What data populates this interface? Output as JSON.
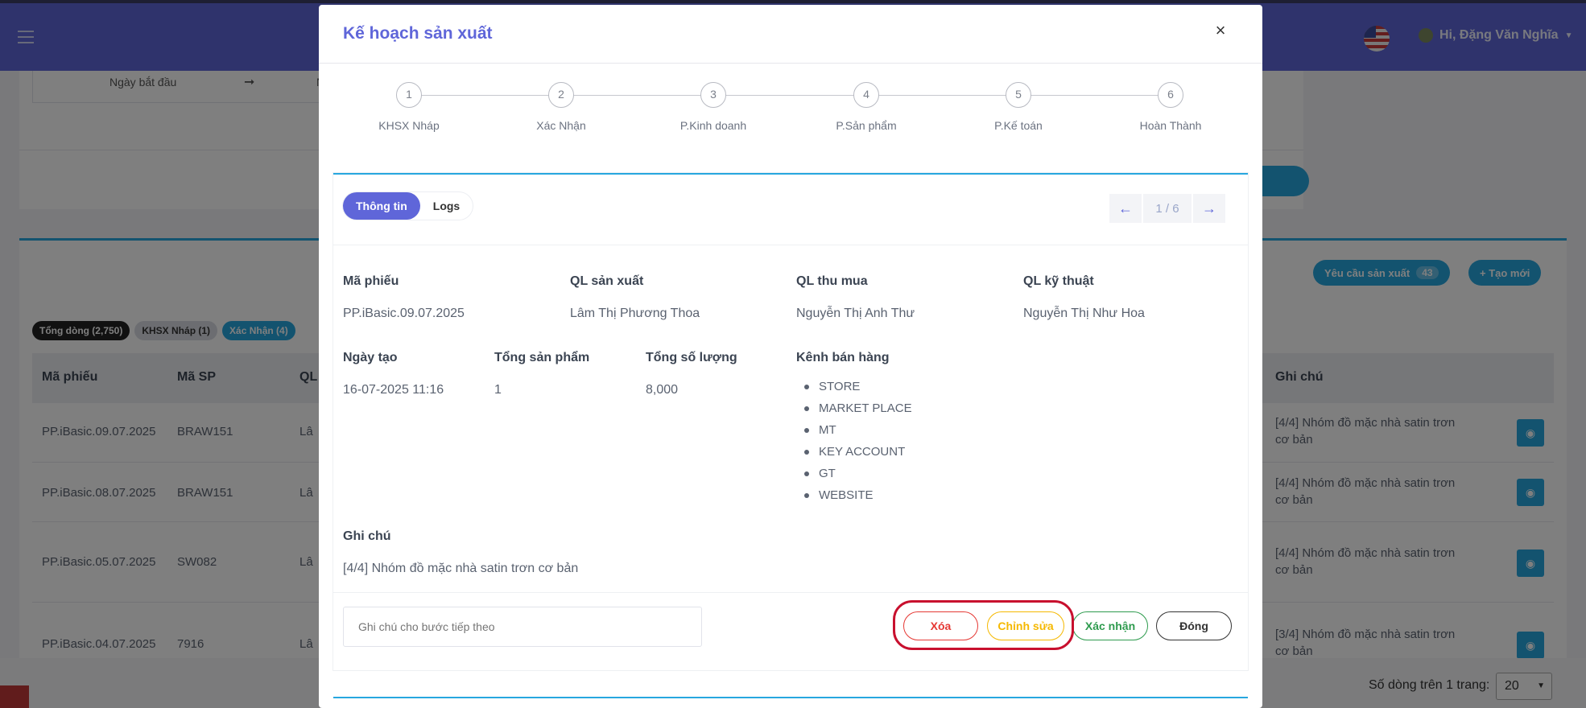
{
  "app": {
    "user_greeting": "Hi, Đặng Văn Nghĩa",
    "filter_start_label": "Ngày bắt đầu",
    "filter_end_label": "Ng",
    "request_button": "Yêu cầu sản xuất",
    "request_count": "43",
    "create_button": "+ Tạo mới",
    "badges": [
      "Tổng dòng (2,750)",
      "KHSX Nháp (1)",
      "Xác Nhận (4)"
    ],
    "table": {
      "headers": [
        "Mã phiếu",
        "Mã SP",
        "QL",
        "Ghi chú"
      ],
      "rows": [
        {
          "code": "PP.iBasic.09.07.2025",
          "sku": "BRAW151",
          "ql": "Lâ",
          "note": "[4/4] Nhóm đồ mặc nhà satin trơn cơ bản"
        },
        {
          "code": "PP.iBasic.08.07.2025",
          "sku": "BRAW151",
          "ql": "Lâ",
          "note": "[4/4] Nhóm đồ mặc nhà satin trơn cơ bản"
        },
        {
          "code": "PP.iBasic.05.07.2025",
          "sku": "SW082",
          "ql": "Lâ",
          "note": "[4/4] Nhóm đồ mặc nhà satin trơn cơ bản"
        },
        {
          "code": "PP.iBasic.04.07.2025",
          "sku": "7916",
          "ql": "Lâ",
          "note": "[3/4] Nhóm đồ mặc nhà satin trơn cơ bản"
        }
      ]
    },
    "pager_label": "Số dòng trên 1 trang:",
    "pager_value": "20"
  },
  "modal": {
    "title": "Kế hoạch sản xuất",
    "close_glyph": "×",
    "steps": [
      {
        "num": "1",
        "label": "KHSX Nháp"
      },
      {
        "num": "2",
        "label": "Xác Nhận"
      },
      {
        "num": "3",
        "label": "P.Kinh doanh"
      },
      {
        "num": "4",
        "label": "P.Sản phẩm"
      },
      {
        "num": "5",
        "label": "P.Kế toán"
      },
      {
        "num": "6",
        "label": "Hoàn Thành"
      }
    ],
    "tabs": {
      "info": "Thông tin",
      "logs": "Logs"
    },
    "nav": {
      "prev": "←",
      "page": "1 / 6",
      "next": "→"
    },
    "fields": {
      "code_label": "Mã phiếu",
      "code_value": "PP.iBasic.09.07.2025",
      "prod_mgr_label": "QL sản xuất",
      "prod_mgr_value": "Lâm Thị Phương Thoa",
      "purchase_mgr_label": "QL thu mua",
      "purchase_mgr_value": "Nguyễn Thị Anh Thư",
      "tech_mgr_label": "QL kỹ thuật",
      "tech_mgr_value": "Nguyễn Thị Như Hoa",
      "created_label": "Ngày tạo",
      "created_value": "16-07-2025 11:16",
      "total_products_label": "Tổng sản phẩm",
      "total_products_value": "1",
      "total_qty_label": "Tổng số lượng",
      "total_qty_value": "8,000",
      "channels_label": "Kênh bán hàng",
      "channels": [
        "STORE",
        "MARKET PLACE",
        "MT",
        "KEY ACCOUNT",
        "GT",
        "WEBSITE"
      ],
      "note_label": "Ghi chú",
      "note_value": "[4/4] Nhóm đồ mặc nhà satin trơn cơ bản"
    },
    "next_note_placeholder": "Ghi chú cho bước tiếp theo",
    "actions": {
      "delete": "Xóa",
      "edit": "Chỉnh sửa",
      "confirm": "Xác nhận",
      "close": "Đóng"
    }
  },
  "colors": {
    "brand": "#5f66d9",
    "accent": "#27a7df",
    "danger": "#e53935",
    "warning": "#f5b800",
    "success": "#2e9b4e",
    "highlight": "#c8102e"
  }
}
